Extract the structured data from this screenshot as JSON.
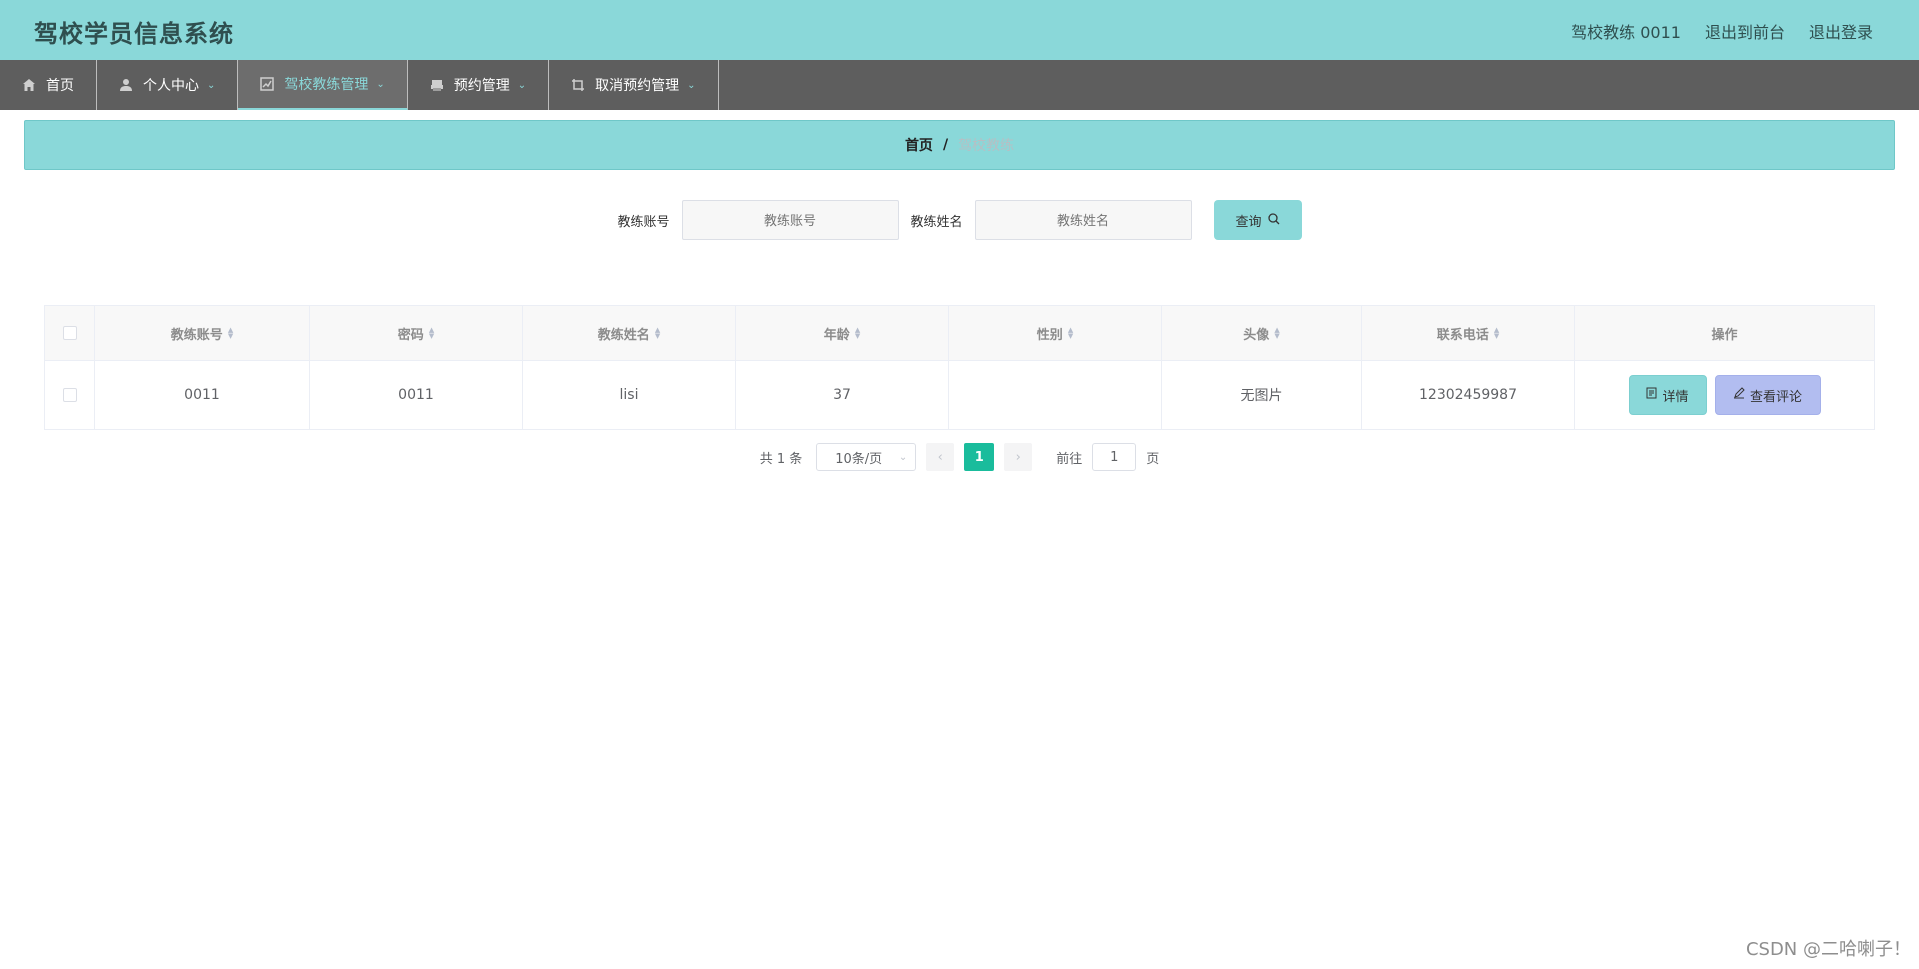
{
  "header": {
    "title": "驾校学员信息系统",
    "user_label": "驾校教练 0011",
    "to_front": "退出到前台",
    "logout": "退出登录"
  },
  "nav": [
    {
      "label": "首页",
      "icon": "home-icon"
    },
    {
      "label": "个人中心",
      "icon": "user-icon"
    },
    {
      "label": "驾校教练管理",
      "icon": "chart-icon"
    },
    {
      "label": "预约管理",
      "icon": "printer-icon"
    },
    {
      "label": "取消预约管理",
      "icon": "crop-icon"
    }
  ],
  "breadcrumb": {
    "home": "首页",
    "sep": "/",
    "current": "驾校教练"
  },
  "search": {
    "account_label": "教练账号",
    "account_placeholder": "教练账号",
    "name_label": "教练姓名",
    "name_placeholder": "教练姓名",
    "button": "查询"
  },
  "table": {
    "headers": [
      "教练账号",
      "密码",
      "教练姓名",
      "年龄",
      "性别",
      "头像",
      "联系电话",
      "操作"
    ],
    "rows": [
      {
        "account": "0011",
        "password": "0011",
        "name": "lisi",
        "age": "37",
        "gender": "",
        "avatar": "无图片",
        "phone": "12302459987"
      }
    ],
    "detail_button": "详情",
    "review_button": "查看评论"
  },
  "pagination": {
    "total": "共 1 条",
    "page_size": "10条/页",
    "current": "1",
    "goto_label": "前往",
    "goto_value": "1",
    "page_suffix": "页"
  },
  "watermark": "CSDN @二哈喇子！",
  "colors": {
    "primary": "#8ad8d9",
    "nav": "#5e5e5e",
    "page_active": "#1abc9c",
    "review": "#b2bdf0"
  }
}
